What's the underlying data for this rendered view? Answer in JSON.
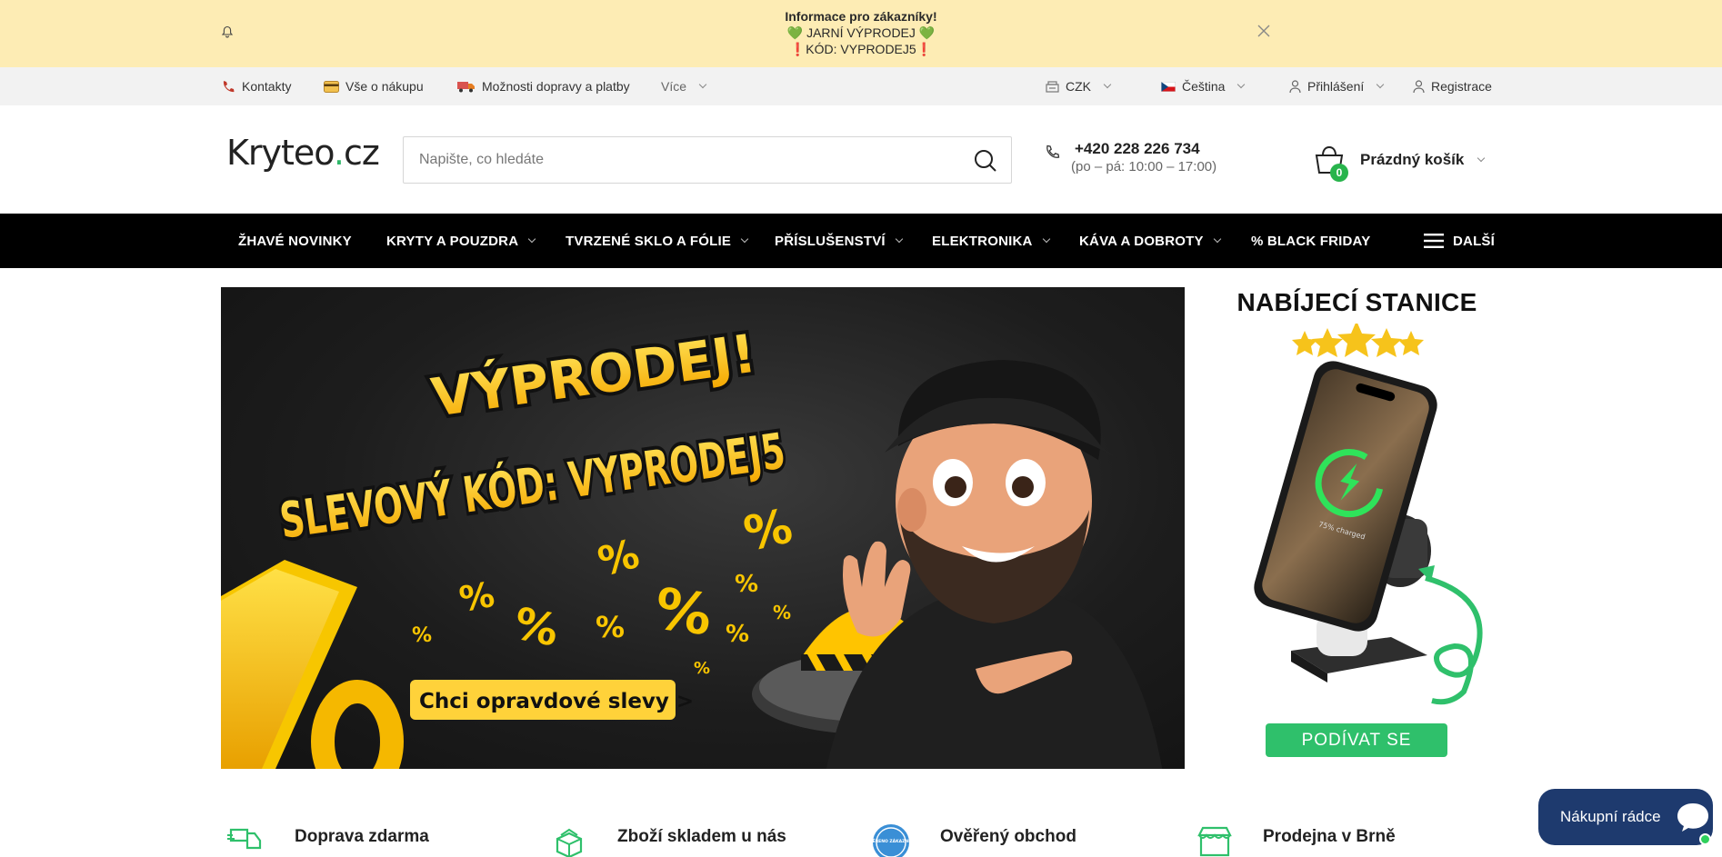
{
  "notice": {
    "title": "Informace pro zákazníky!",
    "line1": "💚 JARNÍ VÝPRODEJ 💚",
    "line2": "❗KÓD: VYPRODEJ5❗"
  },
  "topbar": {
    "contacts": "Kontakty",
    "about": "Vše o nákupu",
    "shipping": "Možnosti dopravy a platby",
    "more": "Více",
    "currency": "CZK",
    "language": "Čeština",
    "login": "Přihlášení",
    "register": "Registrace"
  },
  "header": {
    "logo_main": "Kryteo",
    "logo_dot": ".",
    "logo_tld": "cz",
    "search_placeholder": "Napište, co hledáte",
    "phone": "+420 228 226 734",
    "hours": "(po – pá: 10:00 – 17:00)",
    "cart_count": "0",
    "cart_label": "Prázdný košík"
  },
  "nav": {
    "items": [
      {
        "label": "ŽHAVÉ NOVINKY"
      },
      {
        "label": "KRYTY A POUZDRA"
      },
      {
        "label": "TVRZENÉ SKLO A FÓLIE"
      },
      {
        "label": "PŘÍSLUŠENSTVÍ"
      },
      {
        "label": "ELEKTRONIKA"
      },
      {
        "label": "KÁVA A DOBROTY"
      },
      {
        "label": "% BLACK FRIDAY"
      }
    ],
    "more": "DALŠÍ"
  },
  "banner": {
    "headline1": "VÝPRODEJ!",
    "headline2": "SLEVOVÝ KÓD: VYPRODEJ5",
    "cta": "Chci opravdové slevy >"
  },
  "side_banner": {
    "title": "NABÍJECÍ STANICE",
    "cta": "PODÍVAT SE",
    "phone_text": "75% charged"
  },
  "features": [
    {
      "label": "Doprava zdarma"
    },
    {
      "label": "Zboží skladem u nás"
    },
    {
      "label": "Ověřený obchod",
      "badge_text": "OVĚŘENO ZÁKAZNÍKY"
    },
    {
      "label": "Prodejna v Brně"
    }
  ],
  "chat": {
    "label": "Nákupní rádce"
  },
  "colors": {
    "notice_bg": "#fdecb4",
    "nav_bg": "#000000",
    "accent_green": "#2fc06b",
    "chat_bg": "#1e3a6e"
  }
}
